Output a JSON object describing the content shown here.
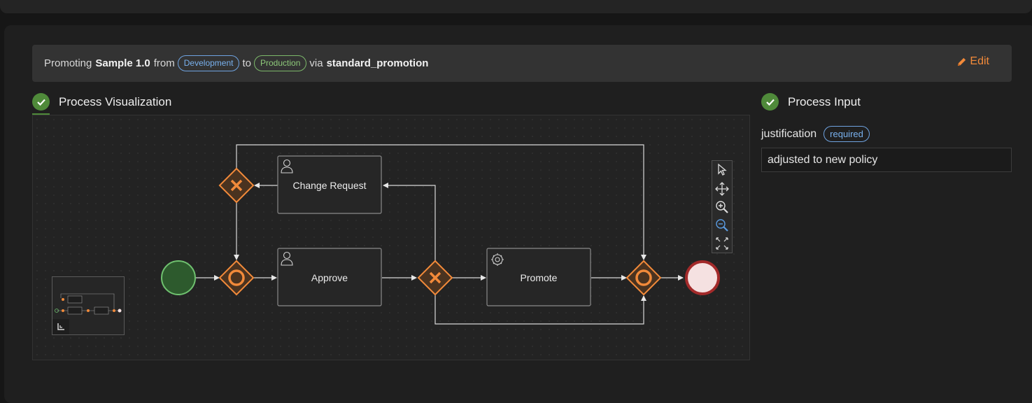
{
  "summary": {
    "prefix": "Promoting",
    "artifact": "Sample 1.0",
    "from_word": "from",
    "source_env": "Development",
    "to_word": "to",
    "target_env": "Production",
    "via_word": "via",
    "workflow": "standard_promotion",
    "edit_label": "Edit"
  },
  "visualization": {
    "title": "Process Visualization",
    "nodes": {
      "change_request": "Change Request",
      "approve": "Approve",
      "promote": "Promote"
    },
    "toolbar": [
      "select-tool-icon",
      "pan-tool-icon",
      "zoom-in-icon",
      "zoom-out-icon",
      "fit-view-icon"
    ]
  },
  "input": {
    "title": "Process Input",
    "field_label": "justification",
    "required_badge": "required",
    "field_value": "adjusted to new policy"
  },
  "colors": {
    "accent_orange": "#f28a3a",
    "success_green": "#4f8a3a",
    "info_blue": "#79b1ee",
    "end_event_red": "#a32a2a"
  }
}
